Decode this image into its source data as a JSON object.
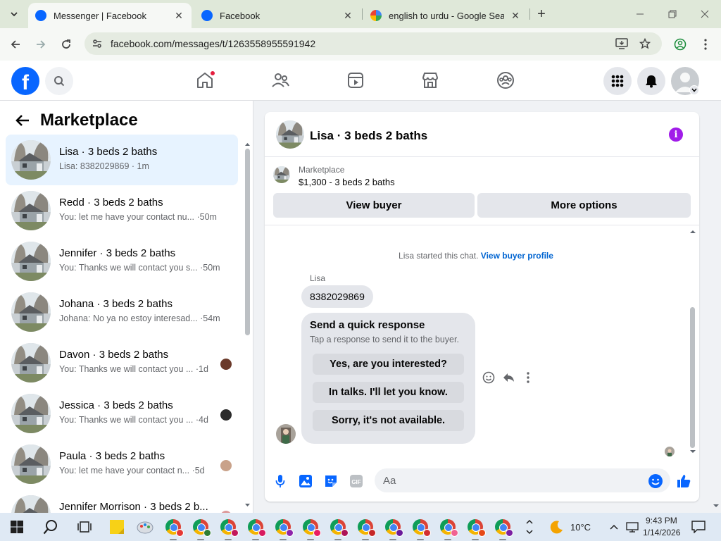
{
  "browser": {
    "tabs": [
      {
        "label": "Messenger | Facebook",
        "active": true
      },
      {
        "label": "Facebook",
        "active": false
      },
      {
        "label": "english to urdu - Google Search",
        "active": false
      }
    ],
    "url": "facebook.com/messages/t/1263558955591942"
  },
  "fb_nav": {
    "logo": "f",
    "left_icons": [
      "search-icon"
    ],
    "center_icons": [
      "home-icon",
      "friends-icon",
      "video-icon",
      "marketplace-icon",
      "groups-icon"
    ],
    "right_icons": [
      "menu-grid-icon",
      "notifications-icon",
      "account-icon"
    ]
  },
  "left_panel": {
    "title": "Marketplace",
    "conversations": [
      {
        "name": "Lisa · 3 beds 2 baths",
        "snippet": "Lisa: 8382029869 · 1m",
        "active": true,
        "avatar_color": ""
      },
      {
        "name": "Redd · 3 beds 2 baths",
        "snippet": "You: let me have your contact nu... ·50m",
        "active": false,
        "avatar_color": ""
      },
      {
        "name": "Jennifer · 3 beds 2 baths",
        "snippet": "You: Thanks we will contact you s... ·50m",
        "active": false,
        "avatar_color": ""
      },
      {
        "name": "Johana · 3 beds 2 baths",
        "snippet": "Johana: No ya no estoy interesad... ·54m",
        "active": false,
        "avatar_color": ""
      },
      {
        "name": "Davon · 3 beds 2 baths",
        "snippet": "You: Thanks we will contact you ... ·1d",
        "active": false,
        "avatar_color": "#6b3a2a"
      },
      {
        "name": "Jessica · 3 beds 2 baths",
        "snippet": "You: Thanks we will contact you ... ·4d",
        "active": false,
        "avatar_color": "#2b2b2b"
      },
      {
        "name": "Paula · 3 beds 2 baths",
        "snippet": "You: let me have your contact n... ·5d",
        "active": false,
        "avatar_color": "#c9a28a"
      },
      {
        "name": "Jennifer Morrison · 3 beds 2 b...",
        "snippet": "",
        "active": false,
        "avatar_color": "#d99"
      }
    ]
  },
  "chat": {
    "title": "Lisa · 3 beds 2 baths",
    "marketplace_label": "Marketplace",
    "listing": "$1,300 - 3 beds 2 baths",
    "view_buyer": "View buyer",
    "more_options": "More options",
    "system_message": "Lisa started this chat.",
    "view_buyer_profile": "View buyer profile",
    "sender": "Lisa",
    "message": "8382029869",
    "quick_response": {
      "title": "Send a quick response",
      "subtitle": "Tap a response to send it to the buyer.",
      "options": [
        "Yes, are you interested?",
        "In talks. I'll let you know.",
        "Sorry, it's not available."
      ]
    },
    "composer_placeholder": "Aa"
  },
  "taskbar": {
    "weather": "10°C",
    "time": "9:43 PM",
    "date": "1/14/2026"
  },
  "colors": {
    "fb_blue": "#0866ff",
    "active_row": "#e7f3ff",
    "info_purple": "#a11ce9",
    "link_blue": "#0064d1",
    "notification_red": "#e41e3f"
  }
}
